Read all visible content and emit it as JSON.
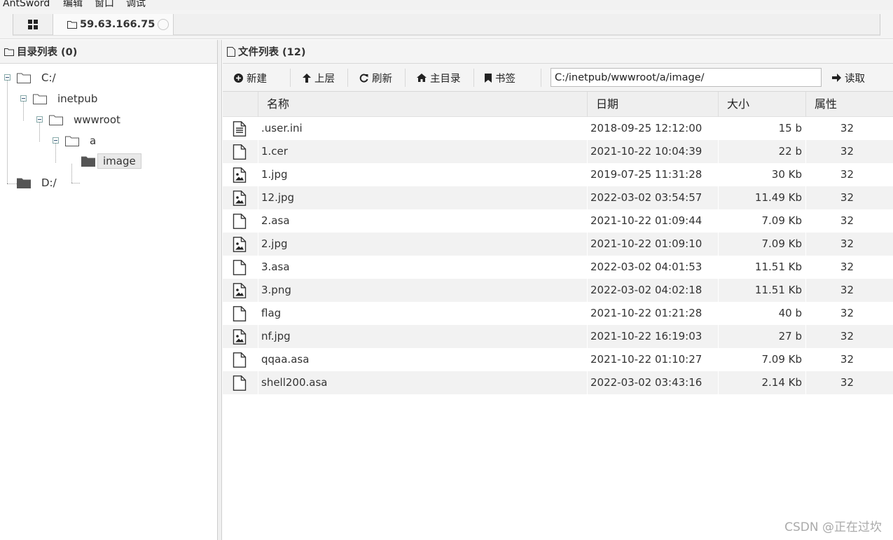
{
  "menubar": {
    "items": [
      "AntSword",
      "编辑",
      "窗口",
      "调试"
    ]
  },
  "tabs": {
    "host": "59.63.166.75"
  },
  "dir_panel": {
    "title": "目录列表 (0)",
    "tree": [
      {
        "label": "C:/"
      },
      {
        "label": "inetpub"
      },
      {
        "label": "wwwroot"
      },
      {
        "label": "a"
      },
      {
        "label": "image",
        "selected": true
      },
      {
        "label": "D:/"
      }
    ]
  },
  "file_panel": {
    "title": "文件列表 (12)",
    "toolbar": {
      "new": "新建",
      "up": "上层",
      "refresh": "刷新",
      "home": "主目录",
      "bookmark": "书签",
      "path": "C:/inetpub/wwwroot/a/image/",
      "read": "读取"
    },
    "columns": [
      "名称",
      "日期",
      "大小",
      "属性"
    ],
    "rows": [
      {
        "icon": "text-file-icon",
        "name": ".user.ini",
        "date": "2018-09-25 12:12:00",
        "size": "15 b",
        "attr": "32"
      },
      {
        "icon": "file-icon",
        "name": "1.cer",
        "date": "2021-10-22 10:04:39",
        "size": "22 b",
        "attr": "32"
      },
      {
        "icon": "image-file-icon",
        "name": "1.jpg",
        "date": "2019-07-25 11:31:28",
        "size": "30 Kb",
        "attr": "32"
      },
      {
        "icon": "image-file-icon",
        "name": "12.jpg",
        "date": "2022-03-02 03:54:57",
        "size": "11.49 Kb",
        "attr": "32"
      },
      {
        "icon": "file-icon",
        "name": "2.asa",
        "date": "2021-10-22 01:09:44",
        "size": "7.09 Kb",
        "attr": "32"
      },
      {
        "icon": "image-file-icon",
        "name": "2.jpg",
        "date": "2021-10-22 01:09:10",
        "size": "7.09 Kb",
        "attr": "32"
      },
      {
        "icon": "file-icon",
        "name": "3.asa",
        "date": "2022-03-02 04:01:53",
        "size": "11.51 Kb",
        "attr": "32"
      },
      {
        "icon": "image-file-icon",
        "name": "3.png",
        "date": "2022-03-02 04:02:18",
        "size": "11.51 Kb",
        "attr": "32"
      },
      {
        "icon": "file-icon",
        "name": "flag",
        "date": "2021-10-22 01:21:28",
        "size": "40 b",
        "attr": "32"
      },
      {
        "icon": "image-file-icon",
        "name": "nf.jpg",
        "date": "2021-10-22 16:19:03",
        "size": "27 b",
        "attr": "32"
      },
      {
        "icon": "file-icon",
        "name": "qqaa.asa",
        "date": "2021-10-22 01:10:27",
        "size": "7.09 Kb",
        "attr": "32"
      },
      {
        "icon": "file-icon",
        "name": "shell200.asa",
        "date": "2022-03-02 03:43:16",
        "size": "2.14 Kb",
        "attr": "32"
      }
    ]
  },
  "watermark": "CSDN @正在过坎"
}
